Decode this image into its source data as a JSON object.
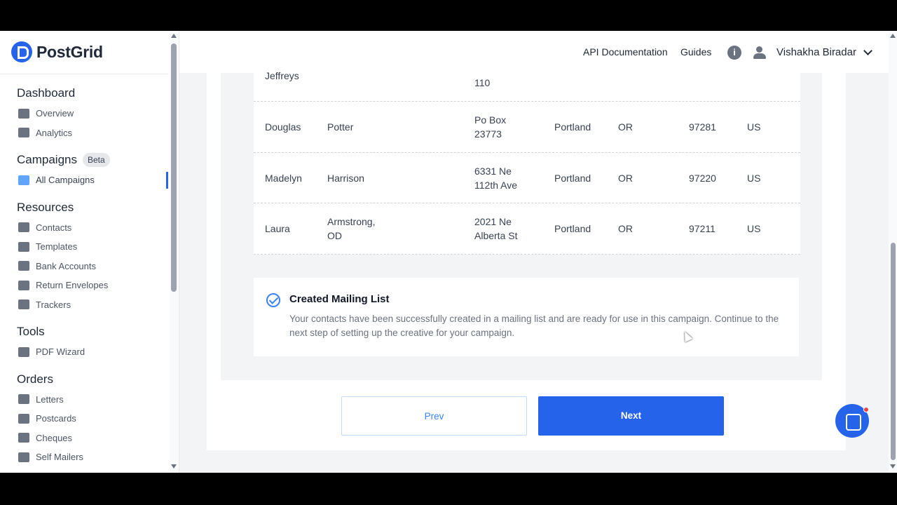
{
  "brand": {
    "name": "PostGrid",
    "accent": "#2563eb"
  },
  "header": {
    "api_docs": "API Documentation",
    "guides": "Guides",
    "info_glyph": "i",
    "user_name": "Vishakha Biradar"
  },
  "sidebar": {
    "sections": [
      {
        "title": "Dashboard",
        "items": [
          {
            "label": "Overview",
            "icon": "home-icon"
          },
          {
            "label": "Analytics",
            "icon": "pie-chart-icon"
          }
        ]
      },
      {
        "title": "Campaigns",
        "badge": "Beta",
        "items": [
          {
            "label": "All Campaigns",
            "icon": "mail-icon",
            "active": true
          }
        ]
      },
      {
        "title": "Resources",
        "items": [
          {
            "label": "Contacts",
            "icon": "contacts-icon"
          },
          {
            "label": "Templates",
            "icon": "templates-icon"
          },
          {
            "label": "Bank Accounts",
            "icon": "bank-icon"
          },
          {
            "label": "Return Envelopes",
            "icon": "envelope-icon"
          },
          {
            "label": "Trackers",
            "icon": "tracker-icon"
          }
        ]
      },
      {
        "title": "Tools",
        "items": [
          {
            "label": "PDF Wizard",
            "icon": "pdf-icon"
          }
        ]
      },
      {
        "title": "Orders",
        "items": [
          {
            "label": "Letters",
            "icon": "letter-icon"
          },
          {
            "label": "Postcards",
            "icon": "postcard-icon"
          },
          {
            "label": "Cheques",
            "icon": "cheque-icon"
          },
          {
            "label": "Self Mailers",
            "icon": "self-mailer-icon"
          }
        ]
      }
    ]
  },
  "table": {
    "rows": [
      {
        "first": "Jeffreys",
        "last": "",
        "address": "110",
        "city": "",
        "state": "",
        "zip": "",
        "country": ""
      },
      {
        "first": "Douglas",
        "last": "Potter",
        "address": "Po Box 23773",
        "city": "Portland",
        "state": "OR",
        "zip": "97281",
        "country": "US"
      },
      {
        "first": "Madelyn",
        "last": "Harrison",
        "address": "6331 Ne 112th Ave",
        "city": "Portland",
        "state": "OR",
        "zip": "97220",
        "country": "US"
      },
      {
        "first": "Laura",
        "last": "Armstrong, OD",
        "address": "2021 Ne Alberta St",
        "city": "Portland",
        "state": "OR",
        "zip": "97211",
        "country": "US"
      }
    ]
  },
  "alert": {
    "title": "Created Mailing List",
    "body": "Your contacts have been successfully created in a mailing list and are ready for use in this campaign. Continue to the next step of setting up the creative for your campaign."
  },
  "buttons": {
    "prev": "Prev",
    "next": "Next"
  }
}
